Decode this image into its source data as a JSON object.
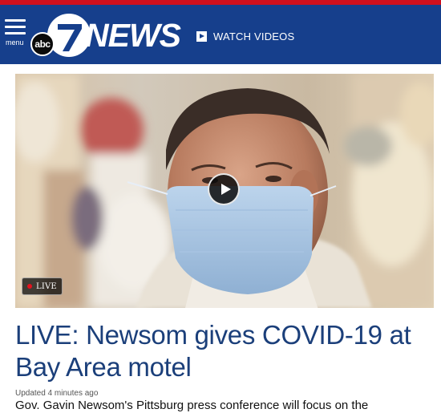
{
  "header": {
    "menu_label": "menu",
    "logo_bug": "abc",
    "logo_number": "7",
    "logo_word": "NEWS",
    "watch_videos_label": "WATCH VIDEOS",
    "brand_color": "#163f8c",
    "accent_color": "#d0101e"
  },
  "video": {
    "live_label": "LIVE",
    "icons": [
      "play-icon",
      "live-dot-icon"
    ]
  },
  "article": {
    "headline": "LIVE: Newsom gives COVID-19 at Bay Area motel",
    "updated": "Updated 4 minutes ago",
    "summary": "Gov. Gavin Newsom's Pittsburg press conference will focus on the"
  }
}
